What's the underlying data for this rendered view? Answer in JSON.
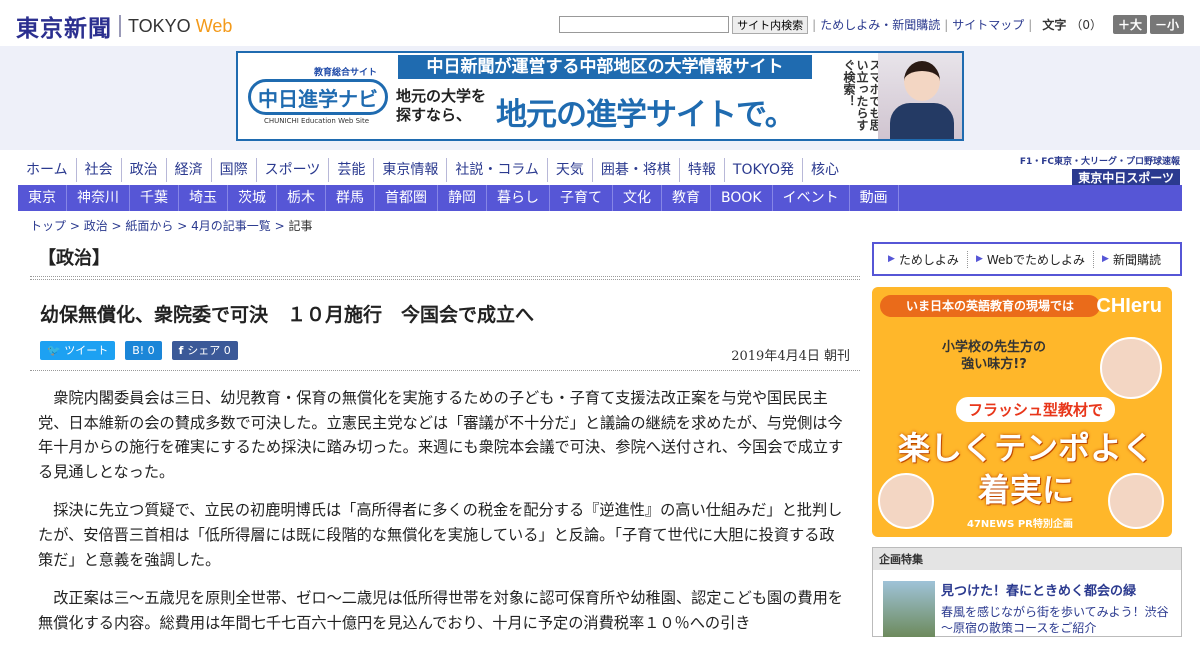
{
  "header": {
    "logo_jp": "東京新聞",
    "logo_en1": "TOKYO",
    "logo_en2": "Web",
    "search_placeholder": "",
    "search_button": "サイト内検索",
    "links": [
      "ためしよみ・新聞購読",
      "サイトマップ"
    ],
    "font_label": "文字",
    "font_count": "（0）",
    "font_plus": "＋大",
    "font_minus": "－小"
  },
  "banner": {
    "brand_top": "教育総合サイト",
    "brand_name": "中日進学ナビ",
    "brand_sub": "CHUNICHI Education Web Site",
    "headline": "中日新聞が運営する中部地区の大学情報サイト",
    "line1a": "地元の大学を",
    "line1b": "探すなら、",
    "line2": "地元の進学サイトで。",
    "vertical": "スマホでも思い立ったらすぐ検索！"
  },
  "nav_primary": [
    "ホーム",
    "社会",
    "政治",
    "経済",
    "国際",
    "スポーツ",
    "芸能",
    "東京情報",
    "社説・コラム",
    "天気",
    "囲碁・将棋",
    "特報",
    "TOKYO発",
    "核心"
  ],
  "sports_link": {
    "line1": "F1・FC東京・大リーグ・プロ野球速報",
    "line2": "東京中日スポーツ"
  },
  "nav_secondary": [
    "東京",
    "神奈川",
    "千葉",
    "埼玉",
    "茨城",
    "栃木",
    "群馬",
    "首都圏",
    "静岡",
    "暮らし",
    "子育て",
    "文化",
    "教育",
    "BOOK",
    "イベント",
    "動画"
  ],
  "breadcrumb": {
    "items": [
      "トップ",
      "政治",
      "紙面から",
      "4月の記事一覧"
    ],
    "current": "記事",
    "sep": " > "
  },
  "article": {
    "section": "【政治】",
    "title": "幼保無償化、衆院委で可決　１０月施行　今国会で成立へ",
    "tweet": "ツイート",
    "hatena": "B! 0",
    "facebook": "シェア 0",
    "date": "2019年4月4日 朝刊",
    "paragraphs": [
      "衆院内閣委員会は三日、幼児教育・保育の無償化を実施するための子ども・子育て支援法改正案を与党や国民民主党、日本維新の会の賛成多数で可決した。立憲民主党などは「審議が不十分だ」と議論の継続を求めたが、与党側は今年十月からの施行を確実にするため採決に踏み切った。来週にも衆院本会議で可決、参院へ送付され、今国会で成立する見通しとなった。",
      "採決に先立つ質疑で、立民の初鹿明博氏は「高所得者に多くの税金を配分する『逆進性』の高い仕組みだ」と批判したが、安倍晋三首相は「低所得層には既に段階的な無償化を実施している」と反論。「子育て世代に大胆に投資する政策だ」と意義を強調した。",
      "改正案は三～五歳児を原則全世帯、ゼロ～二歳児は低所得世帯を対象に認可保育所や幼稚園、認定こども園の費用を無償化する内容。総費用は年間七千七百六十億円を見込んでおり、十月に予定の消費税率１０％への引き"
    ]
  },
  "sidebar": {
    "subscribe": [
      "ためしよみ",
      "Webでためしよみ",
      "新聞購読"
    ],
    "ad": {
      "ribbon": "いま日本の英語教育の現場では",
      "brand": "CHIeru",
      "question": "小学校の先生方の\n強い味方!?",
      "flash": "フラッシュ型教材で",
      "big": "楽しくテンポよく\n着実に",
      "pr": "47NEWS PR特別企画"
    },
    "special": {
      "header": "企画特集",
      "title": "見つけた！春にときめく都会の緑",
      "desc": "春風を感じながら街を歩いてみよう！渋谷～原宿の散策コースをご紹介"
    }
  }
}
